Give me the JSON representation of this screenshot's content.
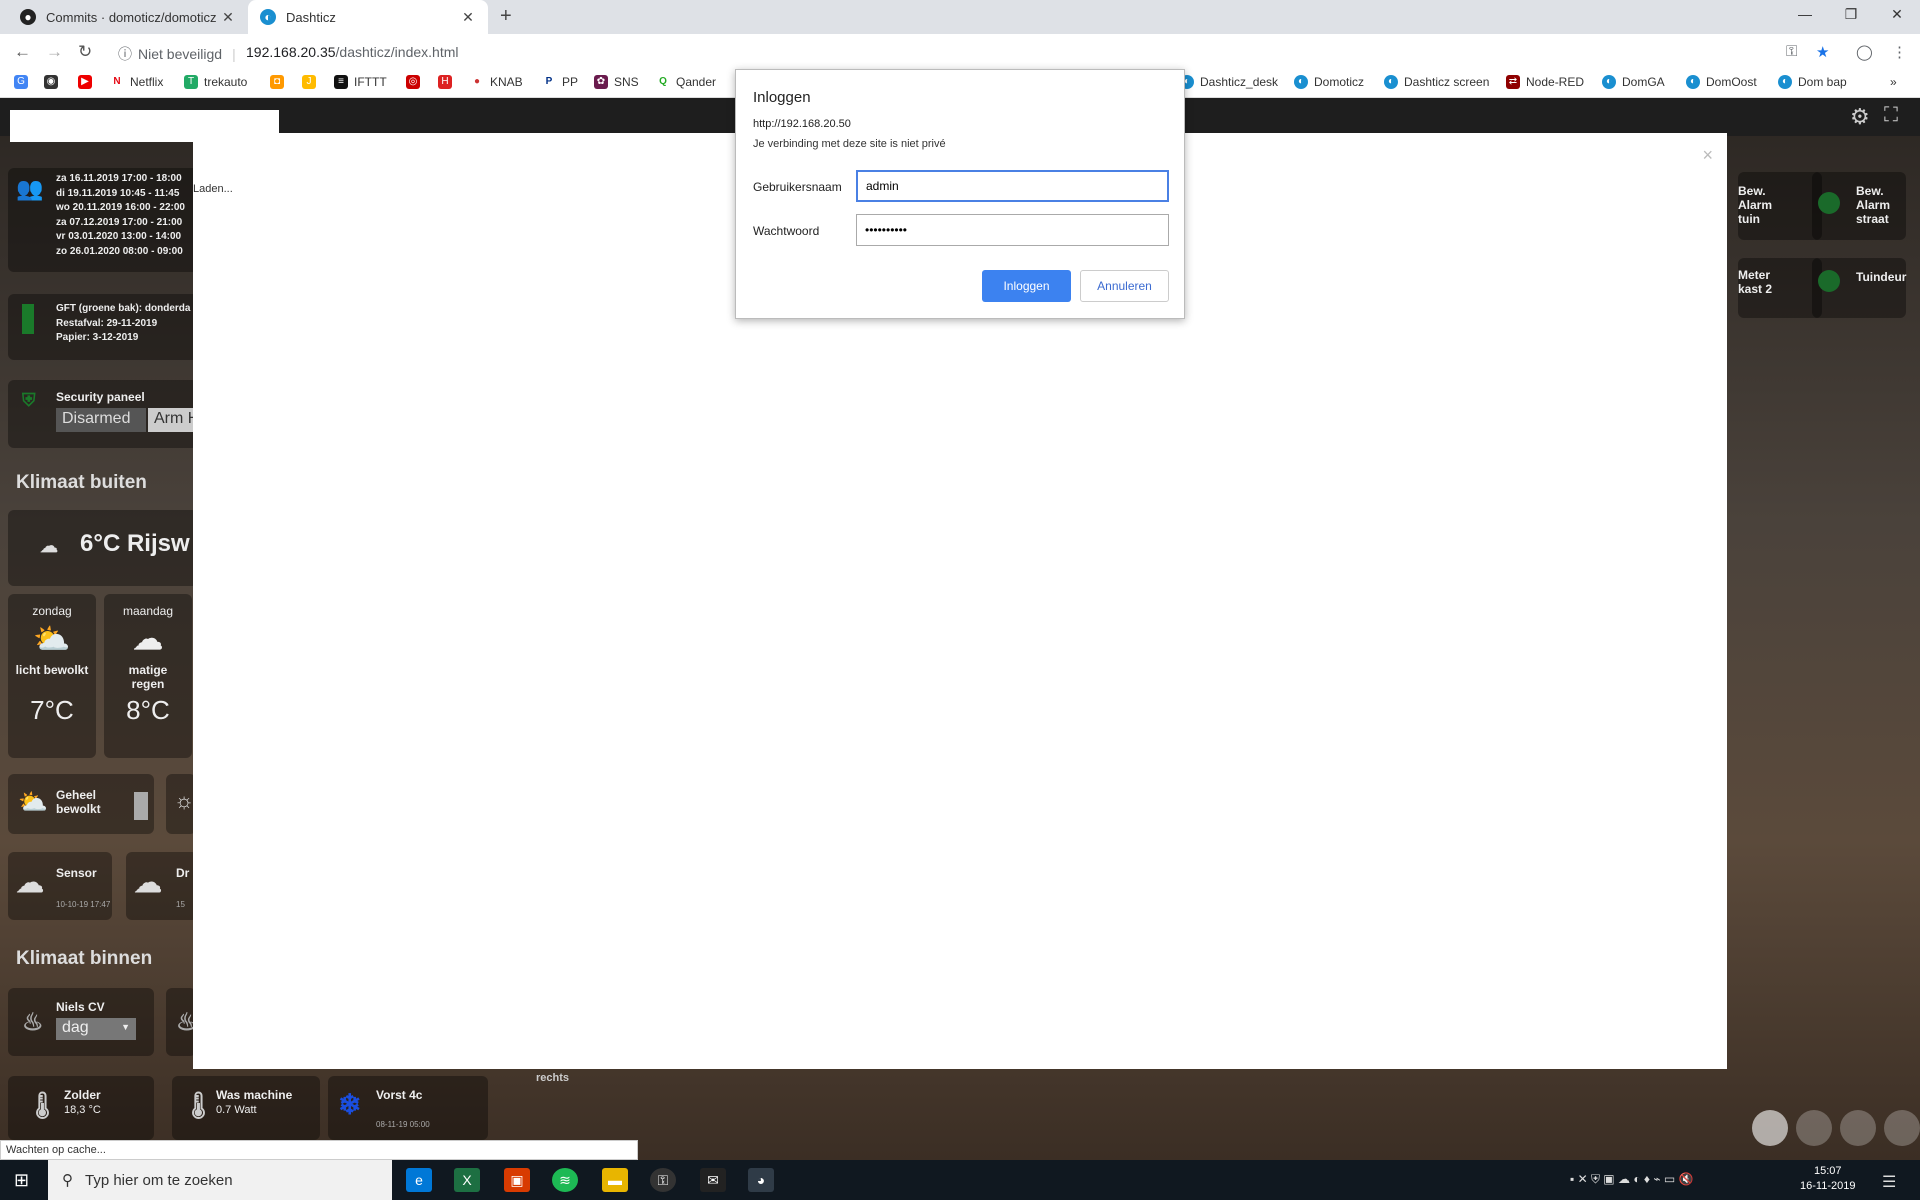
{
  "tabs": [
    {
      "label": "Commits · domoticz/domoticz · G",
      "icon": "github-icon"
    },
    {
      "label": "Dashticz",
      "icon": "dashticz-icon"
    }
  ],
  "toolbar": {
    "security_text": "Niet beveiligd",
    "url_host": "192.168.20.35",
    "url_path": "/dashticz/index.html"
  },
  "bookmarks": [
    {
      "label": "",
      "icon": "google-icon"
    },
    {
      "label": "",
      "icon": "media-icon"
    },
    {
      "label": "",
      "icon": "youtube-icon"
    },
    {
      "label": "Netflix",
      "icon": "netflix-icon"
    },
    {
      "label": "trekauto",
      "icon": "trekauto-icon"
    },
    {
      "label": "",
      "icon": "bookmark-icon"
    },
    {
      "label": "",
      "icon": "bookmark-icon"
    },
    {
      "label": "IFTTT",
      "icon": "ifttt-icon"
    },
    {
      "label": "",
      "icon": "bookmark-icon"
    },
    {
      "label": "",
      "icon": "bookmark-icon"
    },
    {
      "label": "KNAB",
      "icon": "knab-icon"
    },
    {
      "label": "PP",
      "icon": "paypal-icon"
    },
    {
      "label": "SNS",
      "icon": "sns-icon"
    },
    {
      "label": "Qander",
      "icon": "qander-icon"
    },
    {
      "label": "Dashticz_desk",
      "icon": "dashticz-icon"
    },
    {
      "label": "Domoticz",
      "icon": "dashticz-icon"
    },
    {
      "label": "Dashticz screen",
      "icon": "dashticz-icon"
    },
    {
      "label": "Node-RED",
      "icon": "nodered-icon"
    },
    {
      "label": "DomGA",
      "icon": "dashticz-icon"
    },
    {
      "label": "DomOost",
      "icon": "dashticz-icon"
    },
    {
      "label": "Dom bap",
      "icon": "dashticz-icon"
    }
  ],
  "dashboard": {
    "calendar": [
      "za 16.11.2019 17:00 - 18:00",
      "di 19.11.2019 10:45 - 11:45",
      "wo 20.11.2019 16:00 - 22:00",
      "za 07.12.2019 17:00 - 21:00",
      "vr 03.01.2020 13:00 - 14:00",
      "zo 26.01.2020 08:00 - 09:00"
    ],
    "garbage": [
      "GFT (groene bak): donderda",
      "Restafval: 29-11-2019",
      "Papier: 3-12-2019"
    ],
    "security_title": "Security paneel",
    "security_disarmed": "Disarmed",
    "security_arm": "Arm H",
    "section_outside": "Klimaat buiten",
    "current_weather": "6°C  Rijsw",
    "forecast": [
      {
        "day": "zondag",
        "desc": "licht bewolkt",
        "temp": "7°C"
      },
      {
        "day": "maandag",
        "desc": "matige regen",
        "temp": "8°C"
      }
    ],
    "cloudy_label": "Geheel bewolkt",
    "sensor_label": "Sensor",
    "sensor_time": "10-10-19 17:47",
    "dr_label": "Dr",
    "dr_time": "15",
    "section_inside": "Klimaat binnen",
    "cv_label": "Niels CV",
    "cv_select": "dag",
    "zolder_label": "Zolder",
    "zolder_value": "18,3 °C",
    "was_label": "Was machine",
    "was_value": "0.7 Watt",
    "vorst_label": "Vorst 4c",
    "vorst_time": "08-11-19 05:00",
    "rechts_label": "rechts",
    "right_tiles": [
      {
        "label": "Bew. Alarm tuin"
      },
      {
        "label": "Bew. Alarm straat"
      },
      {
        "label": "Meter kast 2"
      },
      {
        "label": "Tuindeur"
      }
    ]
  },
  "modal": {
    "loading": "Laden...",
    "close": "×"
  },
  "status_bar": "Wachten op cache...",
  "auth": {
    "title": "Inloggen",
    "url": "http://192.168.20.50",
    "warning": "Je verbinding met deze site is niet privé",
    "user_label": "Gebruikersnaam",
    "user_value": "admin",
    "pass_label": "Wachtwoord",
    "pass_value": "••••••••••",
    "login_label": "Inloggen",
    "cancel_label": "Annuleren"
  },
  "taskbar": {
    "search_placeholder": "Typ hier om te zoeken",
    "time": "15:07",
    "date": "16-11-2019"
  }
}
